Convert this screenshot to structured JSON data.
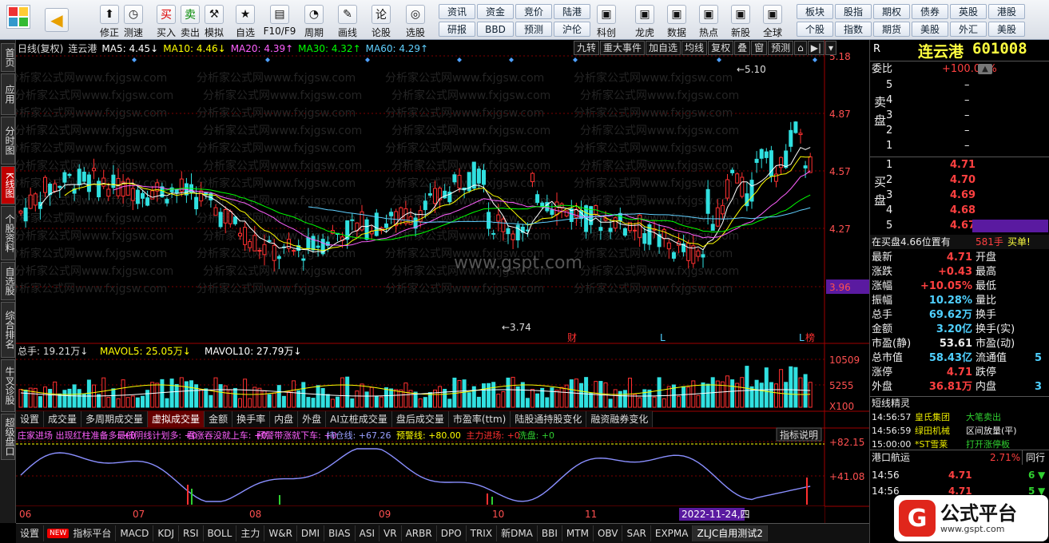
{
  "toolbar": {
    "buttons": [
      {
        "name": "back",
        "label": "",
        "icon": "◀"
      },
      {
        "name": "fix",
        "label": "修正",
        "icon": "⬆"
      },
      {
        "name": "test",
        "label": "测速",
        "icon": "◷"
      },
      {
        "name": "buy",
        "label": "买入",
        "icon": "买"
      },
      {
        "name": "sell",
        "label": "卖出",
        "icon": "卖"
      },
      {
        "name": "simulate",
        "label": "模拟",
        "icon": "⚒"
      },
      {
        "name": "watchlist",
        "label": "自选",
        "icon": "★"
      },
      {
        "name": "f10",
        "label": "F10/F9",
        "icon": "▤"
      },
      {
        "name": "period",
        "label": "周期",
        "icon": "◔"
      },
      {
        "name": "draw",
        "label": "画线",
        "icon": "✎"
      },
      {
        "name": "stock-forum",
        "label": "论股",
        "icon": "论"
      },
      {
        "name": "select-stock",
        "label": "选股",
        "icon": "◎"
      }
    ],
    "quick_row1": [
      "资讯",
      "资金",
      "竞价",
      "陆港",
      "科创",
      "龙虎",
      "数据",
      "热点",
      "新股",
      "全球",
      "板块",
      "股指",
      "期权",
      "债券",
      "英股",
      "港股"
    ],
    "quick_row2": [
      "研报",
      "BBD",
      "预测",
      "沪伦",
      "科创",
      "龙虎",
      "数据",
      "热点",
      "新股",
      "全球",
      "个股",
      "指数",
      "期货",
      "美股",
      "外汇",
      "美股"
    ]
  },
  "sidetabs": [
    "首页",
    "应用",
    "分时图",
    "K线图",
    "个股资料",
    "自选股",
    "综合排名",
    "牛叉诊股",
    "超级盘口"
  ],
  "chart": {
    "title_line": [
      {
        "text": "日线(复权)",
        "color": "#dddddd"
      },
      {
        "text": "连云港",
        "color": "#dddddd"
      },
      {
        "text": "MA5: 4.45↓",
        "color": "#ffffff"
      },
      {
        "text": "MA10: 4.46↓",
        "color": "#ffff00"
      },
      {
        "text": "MA20: 4.39↑",
        "color": "#ff60ff"
      },
      {
        "text": "MA30: 4.32↑",
        "color": "#00ff00"
      },
      {
        "text": "MA60: 4.29↑",
        "color": "#60d0ff"
      }
    ],
    "right_buttons": [
      "九转",
      "重大事件",
      "加自选",
      "均线",
      "复权",
      "叠",
      "窗",
      "预测"
    ],
    "price_axis": [
      "5.18",
      "4.87",
      "4.57",
      "4.27",
      "3.96"
    ],
    "current_price_marker": "3.96",
    "high_label": "5.10",
    "low_label": "3.74",
    "markers": [
      {
        "text": "财",
        "color": "#ff3030"
      },
      {
        "text": "L",
        "color": "#4fd0ff"
      },
      {
        "text": "L",
        "color": "#4fd0ff"
      },
      {
        "text": "榜",
        "color": "#ff3030"
      }
    ],
    "watermark_text": "分析家公式网www.fxjgsw.com",
    "center_watermark": "www.gspt.com",
    "vol_title": [
      {
        "text": "总手: 19.21万↓",
        "color": "#dddddd"
      },
      {
        "text": "MAVOL5: 25.05万↓",
        "color": "#ffff00"
      },
      {
        "text": "MAVOL10: 27.79万↓",
        "color": "#ffffff"
      }
    ],
    "vol_axis": [
      "10509",
      "5255",
      "X100"
    ],
    "indicator_tabs": [
      "设置",
      "成交量",
      "多周期成交量",
      "虚拟成交量",
      "金额",
      "换手率",
      "内盘",
      "外盘",
      "AI立桩成交量",
      "盘后成交量",
      "市盈率(ttm)",
      "陆股通持股变化",
      "融资融券变化"
    ],
    "osc_title": [
      {
        "text": "庄家进场 出现红柱准备多: +0",
        "color": "#ff60ff"
      },
      {
        "text": "最低阴线计划多: +0",
        "color": "#ff60ff"
      },
      {
        "text": "看涨吞没就上车: +0",
        "color": "#ff60ff"
      },
      {
        "text": "预警带涨就下车: +0",
        "color": "#ff60ff"
      },
      {
        "text": "持仓线: +67.26",
        "color": "#9aa0ff"
      },
      {
        "text": "预警线: +80.00",
        "color": "#ffff00"
      },
      {
        "text": "主力进场: +0",
        "color": "#ff3030"
      },
      {
        "text": "洗盘: +0",
        "color": "#30d030"
      }
    ],
    "osc_button": "指标说明",
    "osc_axis": [
      "82.15",
      "41.08"
    ],
    "date_axis": [
      "06",
      "07",
      "08",
      "09",
      "10",
      "11"
    ],
    "date_highlight": "2022-11-24,四"
  },
  "bottom_tabs": [
    "设置",
    "指标平台",
    "MACD",
    "KDJ",
    "RSI",
    "BOLL",
    "主力",
    "W&R",
    "DMI",
    "BIAS",
    "ASI",
    "VR",
    "ARBR",
    "DPO",
    "TRIX",
    "新DMA",
    "BBI",
    "MTM",
    "OBV",
    "SAR",
    "EXPMA",
    "ZLJC自用测试2"
  ],
  "bottom_new_badge": "NEW",
  "right_panel": {
    "badge": "R",
    "stock_name": "连云港",
    "stock_code": "601008",
    "weibi_label": "委比",
    "weibi_value": "+100.00%",
    "sell_label": "卖盘",
    "buy_label": "买盘",
    "sell_levels": [
      {
        "lv": "5",
        "price": "–"
      },
      {
        "lv": "4",
        "price": "–"
      },
      {
        "lv": "3",
        "price": "–"
      },
      {
        "lv": "2",
        "price": "–"
      },
      {
        "lv": "1",
        "price": "–"
      }
    ],
    "buy_levels": [
      {
        "lv": "1",
        "price": "4.71"
      },
      {
        "lv": "2",
        "price": "4.70"
      },
      {
        "lv": "3",
        "price": "4.69"
      },
      {
        "lv": "4",
        "price": "4.68"
      },
      {
        "lv": "5",
        "price": "4.67"
      }
    ],
    "notice": "在买盘4.66位置有",
    "notice_qty": "581手",
    "notice_tag": "买单!",
    "stats_left": [
      {
        "k": "最新",
        "v": "4.71",
        "c": "red"
      },
      {
        "k": "涨跌",
        "v": "+0.43",
        "c": "red"
      },
      {
        "k": "涨幅",
        "v": "+10.05%",
        "c": "red"
      },
      {
        "k": "振幅",
        "v": "10.28%",
        "c": "cyan"
      },
      {
        "k": "总手",
        "v": "69.62万",
        "c": "cyan"
      },
      {
        "k": "金额",
        "v": "3.20亿",
        "c": "cyan"
      },
      {
        "k": "市盈(静)",
        "v": "53.61",
        "c": "white"
      },
      {
        "k": "总市值",
        "v": "58.43亿",
        "c": "cyan"
      },
      {
        "k": "涨停",
        "v": "4.71",
        "c": "red"
      },
      {
        "k": "外盘",
        "v": "36.81万",
        "c": "red"
      }
    ],
    "stats_right": [
      {
        "k": "开盘",
        "v": ""
      },
      {
        "k": "最高",
        "v": ""
      },
      {
        "k": "最低",
        "v": ""
      },
      {
        "k": "量比",
        "v": ""
      },
      {
        "k": "换手",
        "v": ""
      },
      {
        "k": "换手(实)",
        "v": ""
      },
      {
        "k": "市盈(动)",
        "v": ""
      },
      {
        "k": "流通值",
        "v": "5"
      },
      {
        "k": "跌停",
        "v": ""
      },
      {
        "k": "内盘",
        "v": "3"
      }
    ],
    "sprite_title": "短线精灵",
    "sprite": [
      {
        "time": "14:56:57",
        "name": "皇氏集团",
        "event": "大笔卖出",
        "ec": "green"
      },
      {
        "time": "14:56:59",
        "name": "绿田机械",
        "event": "区间放量(平)",
        "ec": "white"
      },
      {
        "time": "15:00:00",
        "name": "*ST雪莱",
        "event": "打开涨停板",
        "ec": "green"
      }
    ],
    "peer_name": "港口航运",
    "peer_change": "2.71%",
    "peer_btn": "同行",
    "ticks": [
      {
        "time": "14:56",
        "price": "4.71",
        "vol": "6"
      },
      {
        "time": "14:56",
        "price": "4.71",
        "vol": "5"
      }
    ],
    "logo_text": "公式平台",
    "logo_url": "www.gspt.com"
  }
}
